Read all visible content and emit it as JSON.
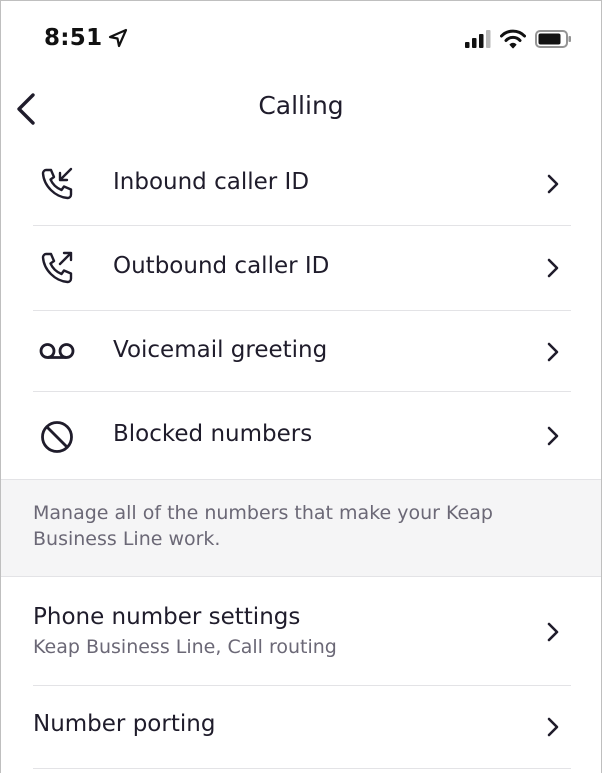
{
  "status_bar": {
    "time": "8:51",
    "location_icon": "location-arrow-icon",
    "signal_icon": "cellular-signal-icon",
    "wifi_icon": "wifi-icon",
    "battery_icon": "battery-icon"
  },
  "nav": {
    "back_icon": "chevron-left-icon",
    "title": "Calling"
  },
  "list": [
    {
      "label": "Inbound caller ID",
      "icon": "phone-incoming-icon"
    },
    {
      "label": "Outbound caller ID",
      "icon": "phone-outgoing-icon"
    },
    {
      "label": "Voicemail greeting",
      "icon": "voicemail-icon"
    },
    {
      "label": "Blocked numbers",
      "icon": "block-icon"
    }
  ],
  "note": {
    "text": "Manage all of the numbers that make your Keap Business Line work."
  },
  "settings": [
    {
      "title": "Phone number settings",
      "subtitle": "Keap Business Line, Call routing"
    },
    {
      "title": "Number porting",
      "subtitle": ""
    }
  ],
  "colors": {
    "text": "#1f1c2b",
    "secondary_text": "#6b6876",
    "divider": "#e3e3e6",
    "note_background": "#f5f5f6"
  }
}
